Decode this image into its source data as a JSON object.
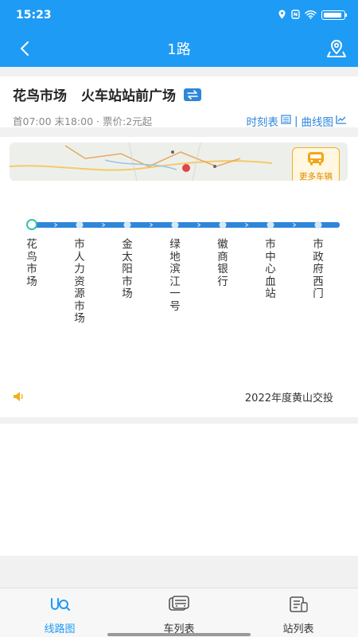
{
  "status_bar": {
    "time": "15:23",
    "battery_text": ""
  },
  "header": {
    "title": "1路"
  },
  "route": {
    "from": "花鸟市场",
    "to": "火车站站前广场",
    "first_bus": "首07:00",
    "last_bus": "末18:00",
    "fare": "票价:2元起",
    "timetable_link": "时刻表",
    "curve_link": "曲线图",
    "link_separator": "|"
  },
  "map": {
    "more_buses_label": "更多车辆"
  },
  "stops": [
    {
      "name": "花鸟市场"
    },
    {
      "name": "市人力资源市场"
    },
    {
      "name": "金太阳市场"
    },
    {
      "name": "绿地滨江一号"
    },
    {
      "name": "徽商银行"
    },
    {
      "name": "市中心血站"
    },
    {
      "name": "市政府西门"
    }
  ],
  "footer": {
    "company": "2022年度黄山交投"
  },
  "tabs": [
    {
      "label": "线路图",
      "active": true
    },
    {
      "label": "车列表",
      "active": false
    },
    {
      "label": "站列表",
      "active": false
    }
  ],
  "colors": {
    "primary": "#1e9bf5",
    "route_line": "#2e86d9",
    "start_stop": "#2fc6a6",
    "accent_orange": "#f0b020"
  }
}
